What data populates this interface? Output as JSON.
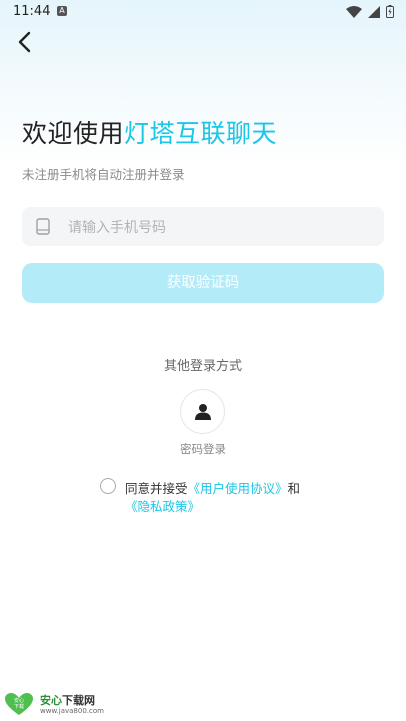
{
  "status_bar": {
    "time": "11:44",
    "notification_letter": "A"
  },
  "header": {
    "title_prefix": "欢迎使用",
    "title_app": "灯塔互联聊天",
    "subtitle": "未注册手机将自动注册并登录"
  },
  "form": {
    "phone_placeholder": "请输入手机号码",
    "phone_value": "",
    "code_button": "获取验证码"
  },
  "other_login": {
    "title": "其他登录方式",
    "password_login": "密码登录"
  },
  "agreement": {
    "prefix": "同意并接受",
    "user_agreement": "《用户使用协议》",
    "conjunction": "和",
    "privacy_policy": "《隐私政策》",
    "checked": false
  },
  "watermark": {
    "title": "安心",
    "title_suffix": "下载网",
    "url": "www.java800.com",
    "logo_text_top": "安心",
    "logo_text_bottom": "下载"
  },
  "colors": {
    "accent": "#1cc6e6",
    "button_disabled": "#b4ebf9",
    "field_bg": "#f4f5f7"
  }
}
